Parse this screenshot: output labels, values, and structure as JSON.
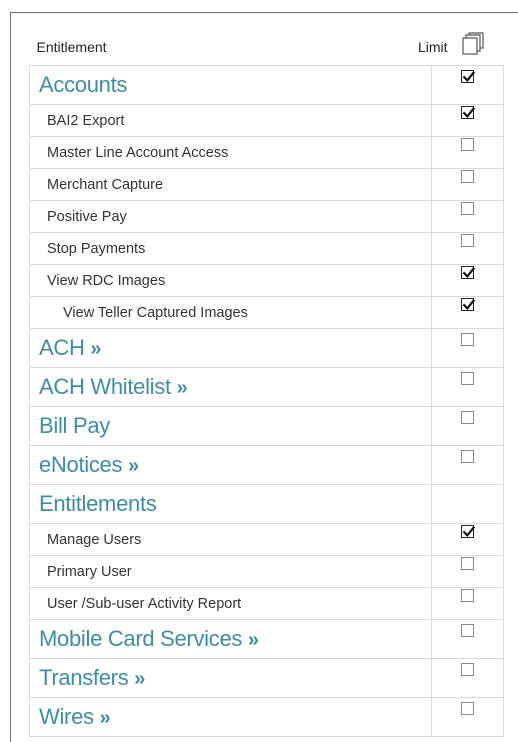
{
  "header": {
    "entitlement_label": "Entitlement",
    "limit_label": "Limit",
    "copy_icon": "copy-icon"
  },
  "rows": [
    {
      "label": "Accounts",
      "type": "group",
      "arrow": false,
      "checked": true,
      "has_checkbox": true
    },
    {
      "label": "BAI2 Export",
      "type": "item",
      "checked": true,
      "has_checkbox": true
    },
    {
      "label": "Master Line Account Access",
      "type": "item",
      "checked": false,
      "has_checkbox": true
    },
    {
      "label": "Merchant Capture",
      "type": "item",
      "checked": false,
      "has_checkbox": true
    },
    {
      "label": "Positive Pay",
      "type": "item",
      "checked": false,
      "has_checkbox": true
    },
    {
      "label": "Stop Payments",
      "type": "item",
      "checked": false,
      "has_checkbox": true
    },
    {
      "label": "View RDC Images",
      "type": "item",
      "checked": true,
      "has_checkbox": true
    },
    {
      "label": "View Teller Captured Images",
      "type": "subitem",
      "checked": true,
      "has_checkbox": true
    },
    {
      "label": "ACH",
      "type": "group",
      "arrow": true,
      "checked": false,
      "has_checkbox": true
    },
    {
      "label": "ACH Whitelist",
      "type": "group",
      "arrow": true,
      "checked": false,
      "has_checkbox": true
    },
    {
      "label": "Bill Pay",
      "type": "group",
      "arrow": false,
      "checked": false,
      "has_checkbox": true
    },
    {
      "label": "eNotices",
      "type": "group",
      "arrow": true,
      "checked": false,
      "has_checkbox": true
    },
    {
      "label": "Entitlements",
      "type": "group",
      "arrow": false,
      "checked": false,
      "has_checkbox": false
    },
    {
      "label": "Manage Users",
      "type": "item",
      "checked": true,
      "has_checkbox": true
    },
    {
      "label": "Primary User",
      "type": "item",
      "checked": false,
      "has_checkbox": true
    },
    {
      "label": "User /Sub-user Activity Report",
      "type": "item",
      "checked": false,
      "has_checkbox": true
    },
    {
      "label": "Mobile Card Services",
      "type": "group",
      "arrow": true,
      "checked": false,
      "has_checkbox": true
    },
    {
      "label": "Transfers",
      "type": "group",
      "arrow": true,
      "checked": false,
      "has_checkbox": true
    },
    {
      "label": "Wires",
      "type": "group",
      "arrow": true,
      "checked": false,
      "has_checkbox": true
    }
  ],
  "arrow_symbol": "»",
  "colors": {
    "group_text": "#3d8da5",
    "item_text": "#333333",
    "border": "#d9d9d9"
  }
}
